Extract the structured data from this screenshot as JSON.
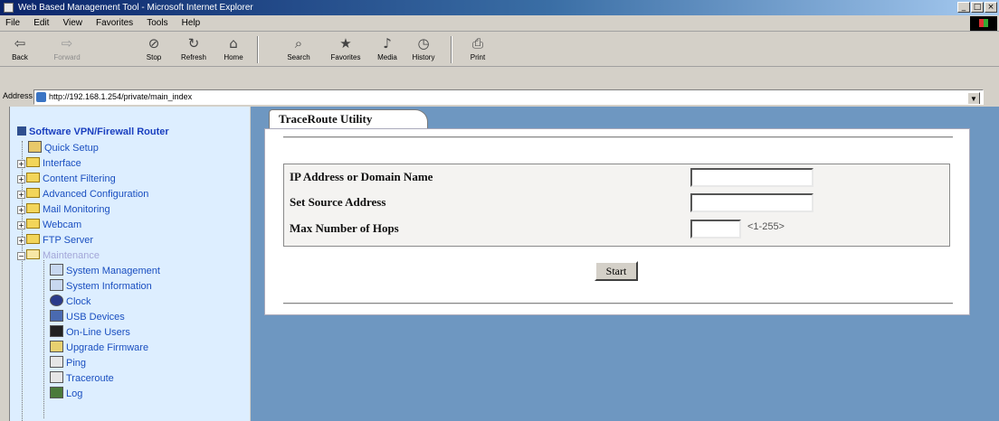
{
  "window": {
    "title": "Web Based Management Tool - Microsoft Internet Explorer",
    "controls": [
      "_",
      "□",
      "×"
    ]
  },
  "menu": [
    "File",
    "Edit",
    "View",
    "Favorites",
    "Tools",
    "Help"
  ],
  "toolbar": {
    "back": "Back",
    "forward": "Forward",
    "stop": "Stop",
    "refresh": "Refresh",
    "home": "Home",
    "search": "Search",
    "favorites": "Favorites",
    "media": "Media",
    "history": "History",
    "print": "Print"
  },
  "address": {
    "label": "Address",
    "url": "http://192.168.1.254/private/main_index"
  },
  "sidebar": {
    "title": "Software VPN/Firewall Router",
    "items": [
      {
        "label": "Quick Setup"
      },
      {
        "label": "Interface"
      },
      {
        "label": "Content Filtering"
      },
      {
        "label": "Advanced Configuration"
      },
      {
        "label": "Mail Monitoring"
      },
      {
        "label": "Webcam"
      },
      {
        "label": "FTP Server"
      },
      {
        "label": "Maintenance"
      },
      {
        "label": "System Management"
      },
      {
        "label": "System Information"
      },
      {
        "label": "Clock"
      },
      {
        "label": "USB Devices"
      },
      {
        "label": "On-Line Users"
      },
      {
        "label": "Upgrade Firmware"
      },
      {
        "label": "Ping"
      },
      {
        "label": "Traceroute"
      },
      {
        "label": "Log"
      }
    ]
  },
  "main": {
    "tab_label": "TraceRoute Utility",
    "fields": [
      {
        "label": "IP Address or Domain Name",
        "value": ""
      },
      {
        "label": "Set Source Address",
        "value": ""
      },
      {
        "label": "Max Number of Hops",
        "value": "",
        "hint": "<1-255>"
      }
    ],
    "start_label": "Start"
  }
}
